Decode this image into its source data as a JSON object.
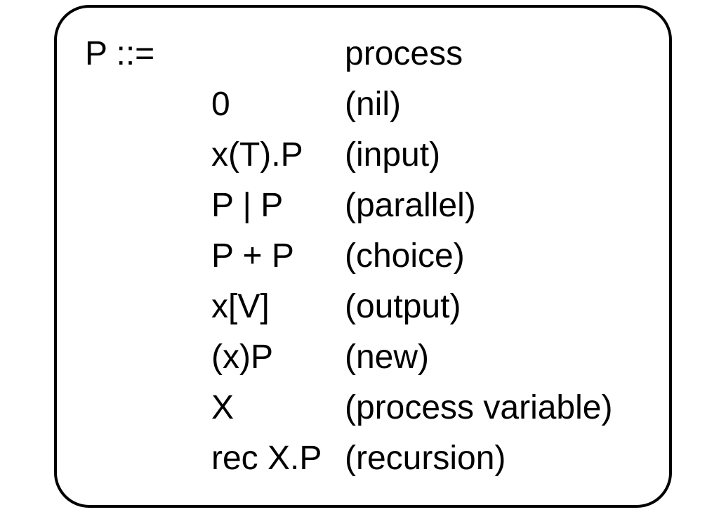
{
  "grammar": {
    "lhs": "P ::=",
    "rows": [
      {
        "rhs": "",
        "desc": "process"
      },
      {
        "rhs": "0",
        "desc": "(nil)"
      },
      {
        "rhs": "x(T).P",
        "desc": "(input)"
      },
      {
        "rhs": "P | P",
        "desc": "(parallel)"
      },
      {
        "rhs": "P + P",
        "desc": "(choice)"
      },
      {
        "rhs": "x[V]",
        "desc": "(output)"
      },
      {
        "rhs": "(x)P",
        "desc": "(new)"
      },
      {
        "rhs": "X",
        "desc": "(process variable)"
      },
      {
        "rhs": "rec X.P",
        "desc": "(recursion)"
      }
    ]
  }
}
